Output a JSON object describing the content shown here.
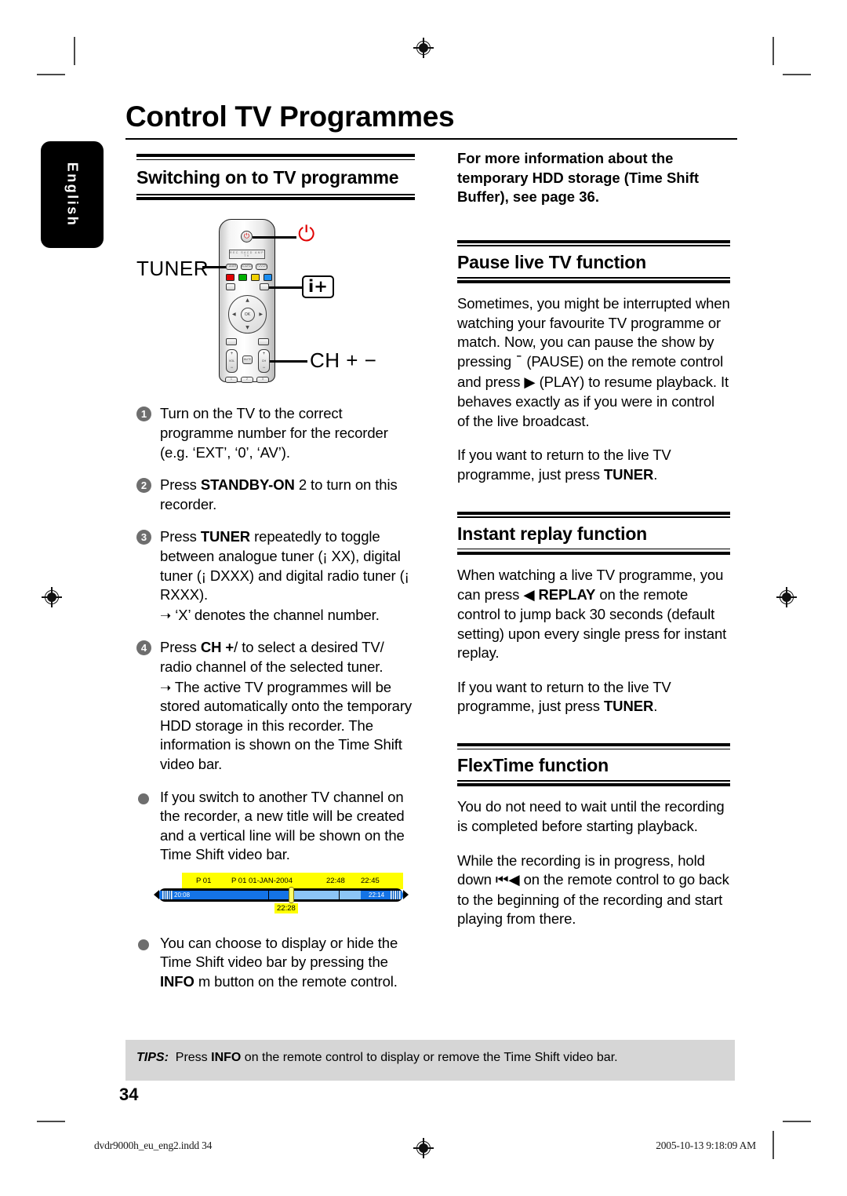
{
  "page": {
    "title": "Control TV Programmes",
    "language_tab": "English",
    "page_number": "34"
  },
  "left_column": {
    "heading": "Switching on to TV programme",
    "remote_callouts": {
      "tuner": "TUNER",
      "power": "⏻",
      "info": "i+",
      "channel": "CH + −",
      "display_text": "REC  SACD  AMP  TV"
    },
    "steps": [
      {
        "num": "1",
        "text": "Turn on the TV to the correct programme number for the recorder (e.g. ‘EXT’, ‘0’, ‘AV’)."
      },
      {
        "num": "2",
        "pre": "Press ",
        "bold": "STANDBY-ON",
        "post": " 2   to turn on this recorder."
      },
      {
        "num": "3",
        "pre": "Press ",
        "bold": "TUNER",
        "post": " repeatedly to toggle between analogue tuner (¡ XX), digital tuner (¡ DXXX) and digital radio tuner (¡ RXXX).",
        "sub": "‘X’ denotes the channel number."
      },
      {
        "num": "4",
        "pre": "Press ",
        "bold": "CH +",
        "post": "/  to select a desired TV/ radio channel of the selected tuner.",
        "sub": "The active TV programmes will be stored automatically onto the temporary HDD storage in this recorder. The information is shown on the Time Shift video bar."
      }
    ],
    "bullets": [
      {
        "text": "If you switch to another TV channel on the recorder, a new title will be created and a vertical line will be shown on the Time Shift video bar."
      },
      {
        "pre": "You can choose to display or hide the Time Shift video bar by pressing the ",
        "bold": "INFO",
        "post": " m  button on the remote control."
      }
    ],
    "time_shift_bar": {
      "label_p01": "P 01",
      "label_programme": "P 01 01-JAN-2004",
      "label_time_1": "22:48",
      "label_time_2": "22:45",
      "marker_time": "22:28",
      "start_time": "20:08",
      "end_time": "22:14",
      "color_track": "#000000",
      "color_filled": "#1473e6",
      "color_buffer": "#8cc5f5",
      "color_highlight": "#ffff00"
    }
  },
  "right_column": {
    "note": "For more information about the temporary HDD storage (Time Shift Buffer), see page 36.",
    "sections": [
      {
        "heading": "Pause live TV function",
        "paragraphs": [
          {
            "parts": [
              {
                "t": "Sometimes, you might be interrupted when watching your favourite TV programme or match. Now, you can pause the show by pressing "
              },
              {
                "t": "¯",
                "s": "glyph"
              },
              {
                "t": "  (PAUSE) on the remote control and press "
              },
              {
                "t": "▶",
                "s": "glyph"
              },
              {
                "t": " (PLAY) to resume playback. It behaves exactly as if you were in control of the live broadcast."
              }
            ]
          },
          {
            "parts": [
              {
                "t": "If you want to return to the live TV programme, just press "
              },
              {
                "t": "TUNER",
                "s": "b"
              },
              {
                "t": "."
              }
            ]
          }
        ]
      },
      {
        "heading": "Instant replay function",
        "paragraphs": [
          {
            "parts": [
              {
                "t": "When watching a live TV programme, you can press "
              },
              {
                "t": "◀",
                "s": "glyph"
              },
              {
                "t": " "
              },
              {
                "t": "REPLAY",
                "s": "b"
              },
              {
                "t": " on the remote control to jump back 30 seconds (default setting) upon every single press for instant replay."
              }
            ]
          },
          {
            "parts": [
              {
                "t": "If you want to return to the live TV programme, just press "
              },
              {
                "t": "TUNER",
                "s": "b"
              },
              {
                "t": "."
              }
            ]
          }
        ]
      },
      {
        "heading": "FlexTime function",
        "paragraphs": [
          {
            "parts": [
              {
                "t": "You do not need to wait until the recording is completed before starting playback."
              }
            ]
          },
          {
            "parts": [
              {
                "t": "While the recording is in progress, hold down "
              },
              {
                "t": "⏮◀",
                "s": "glyph"
              },
              {
                "t": " on the remote control to go back to the beginning of the recording and start playing from there."
              }
            ]
          }
        ]
      }
    ]
  },
  "tips": {
    "label": "TIPS:",
    "pre": "Press ",
    "bold": "INFO",
    "post": " on the remote control to display or remove the Time Shift video bar."
  },
  "print_footer": {
    "file": "dvdr9000h_eu_eng2.indd   34",
    "timestamp": "2005-10-13   9:18:09 AM"
  }
}
